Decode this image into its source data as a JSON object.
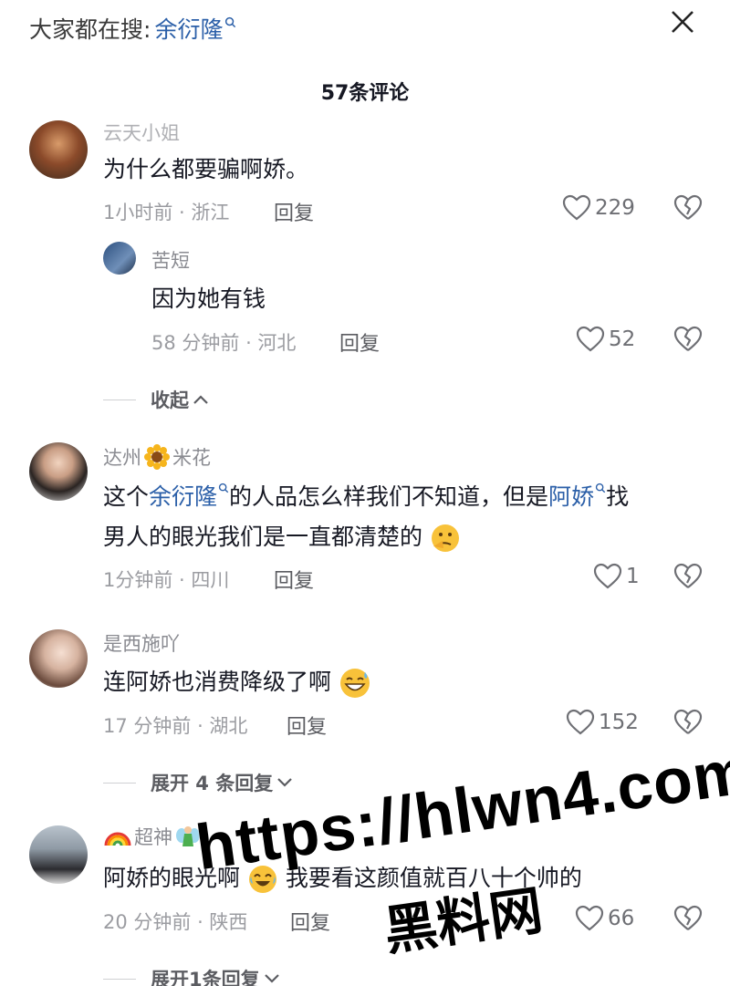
{
  "search": {
    "prefix": "大家都在搜:",
    "term": "余衍隆"
  },
  "header": {
    "comment_count": "57条评论"
  },
  "comments": [
    {
      "username": "云天小姐",
      "text": "为什么都要骗啊娇。",
      "time": "1小时前 · 浙江",
      "reply_label": "回复",
      "likes": "229"
    },
    {
      "username": "苦短",
      "text": "因为她有钱",
      "time": "58 分钟前 · 河北",
      "reply_label": "回复",
      "likes": "52"
    },
    {
      "username_a": "达州",
      "username_b": "米花",
      "text_a": "这个",
      "link_a": "余衍隆",
      "text_b": "的人品怎么样我们不知道，但是",
      "link_b": "阿娇",
      "text_c": "找",
      "text_d": "男人的眼光我们是一直都清楚的",
      "time": "1分钟前 · 四川",
      "reply_label": "回复",
      "likes": "1"
    },
    {
      "username": "是西施吖",
      "text": "连阿娇也消费降级了啊",
      "time": "17 分钟前 · 湖北",
      "reply_label": "回复",
      "likes": "152"
    },
    {
      "username": "超神",
      "text_a": "阿娇的眼光啊",
      "text_b": "我要看这颜值就百八十个帅的",
      "time": "20 分钟前 · 陕西",
      "reply_label": "回复",
      "likes": "66"
    }
  ],
  "collapse_label": "收起",
  "expand_4": "展开 4 条回复",
  "expand_1": "展开1条回复",
  "watermark": {
    "url": "https://hlwn4.com",
    "name": "黑料网"
  },
  "colors": {
    "link": "#2b5fa8",
    "meta": "#9b9ca1",
    "text": "#161823"
  }
}
